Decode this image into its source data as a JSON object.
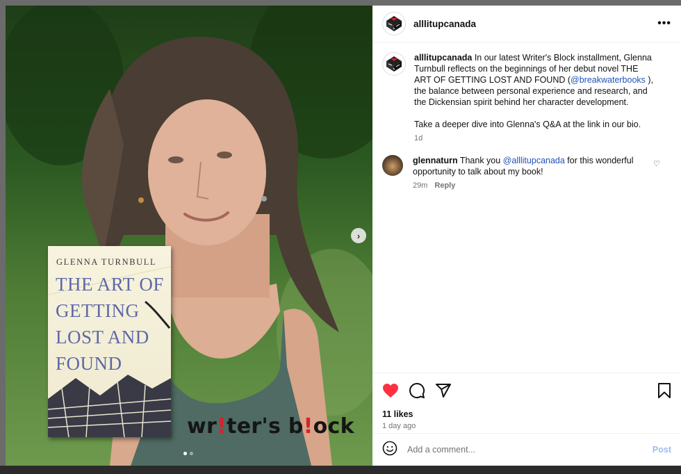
{
  "post": {
    "username": "alllitupcanada",
    "more_label": "•••",
    "caption_parts": {
      "user": "alllitupcanada",
      "text1": " In our latest Writer's Block installment, Glenna Turnbull reflects on the beginnings of her debut novel THE ART OF GETTING LOST AND FOUND (",
      "mention": "@breakwaterbooks",
      "text2": " ), the balance between personal experience and research, and the Dickensian spirit behind her character development.",
      "text3": "Take a deeper dive into Glenna's Q&A at the link in our bio."
    },
    "caption_time": "1d"
  },
  "comment": {
    "user": "glennaturn",
    "text1": " Thank you ",
    "mention": "@alllitupcanada",
    "text2": " for this wonderful opportunity to talk about my book!",
    "time": "29m",
    "reply_label": "Reply"
  },
  "actions": {
    "likes": "11 likes",
    "date": "1 day ago",
    "heart_color": "#ff3040"
  },
  "add_comment": {
    "placeholder": "Add a comment...",
    "post_label": "Post"
  },
  "media": {
    "book_author": "GLENNA TURNBULL",
    "book_title": "THE ART OF GETTING LOST AND FOUND",
    "brand_prefix": "wr",
    "brand_bang1": "!",
    "brand_mid": "ter's b",
    "brand_bang2": "!",
    "brand_suffix": "ock",
    "carousel_count": 2,
    "carousel_active": 1
  }
}
